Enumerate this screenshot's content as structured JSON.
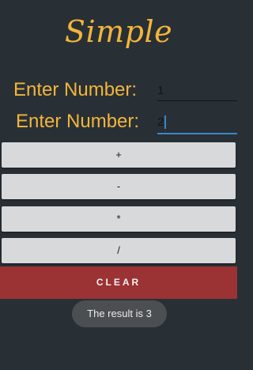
{
  "app": {
    "title": "Simple"
  },
  "inputs": [
    {
      "label": "Enter Number:",
      "value": "1"
    },
    {
      "label": "Enter Number:",
      "value": "2"
    }
  ],
  "buttons": {
    "add": "+",
    "subtract": "-",
    "multiply": "*",
    "divide": "/",
    "clear": "CLEAR"
  },
  "toast": {
    "message": "The result is 3"
  },
  "colors": {
    "background": "#283036",
    "accent": "#f3b53a",
    "button": "#d8d9da",
    "clear_button": "#9b3233",
    "focus_underline": "#3a86c8",
    "toast": "#4b4f52"
  }
}
